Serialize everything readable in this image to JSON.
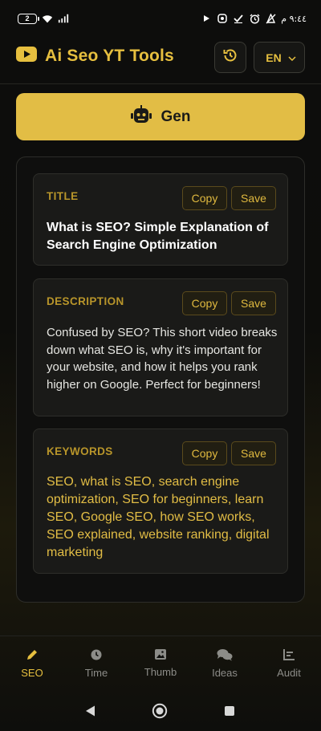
{
  "status_bar": {
    "battery_level": "2",
    "time": "٩:٤٤ م"
  },
  "header": {
    "title": "Ai Seo YT Tools",
    "language": "EN"
  },
  "gen_button": {
    "label": "Gen"
  },
  "cards": [
    {
      "label": "TITLE",
      "copy_label": "Copy",
      "save_label": "Save",
      "text": "What is SEO? Simple Explanation of Search Engine Optimization"
    },
    {
      "label": "DESCRIPTION",
      "copy_label": "Copy",
      "save_label": "Save",
      "text": "Confused by SEO? This short video breaks down what SEO is, why it's important for your website, and how it helps you rank higher on Google. Perfect for beginners!"
    },
    {
      "label": "KEYWORDS",
      "copy_label": "Copy",
      "save_label": "Save",
      "text": "SEO, what is SEO, search engine optimization, SEO for beginners, learn SEO, Google SEO, how SEO works, SEO explained, website ranking, digital marketing"
    }
  ],
  "bottom_nav": [
    {
      "label": "SEO",
      "icon": "pencil-icon",
      "active": true
    },
    {
      "label": "Time",
      "icon": "clock-icon",
      "active": false
    },
    {
      "label": "Thumb",
      "icon": "image-icon",
      "active": false
    },
    {
      "label": "Ideas",
      "icon": "chat-bubbles-icon",
      "active": false
    },
    {
      "label": "Audit",
      "icon": "bar-list-icon",
      "active": false
    }
  ],
  "colors": {
    "accent": "#e2bd45",
    "background": "#0b0b0a",
    "card": "#1a1a18",
    "muted": "#8c8c88"
  }
}
